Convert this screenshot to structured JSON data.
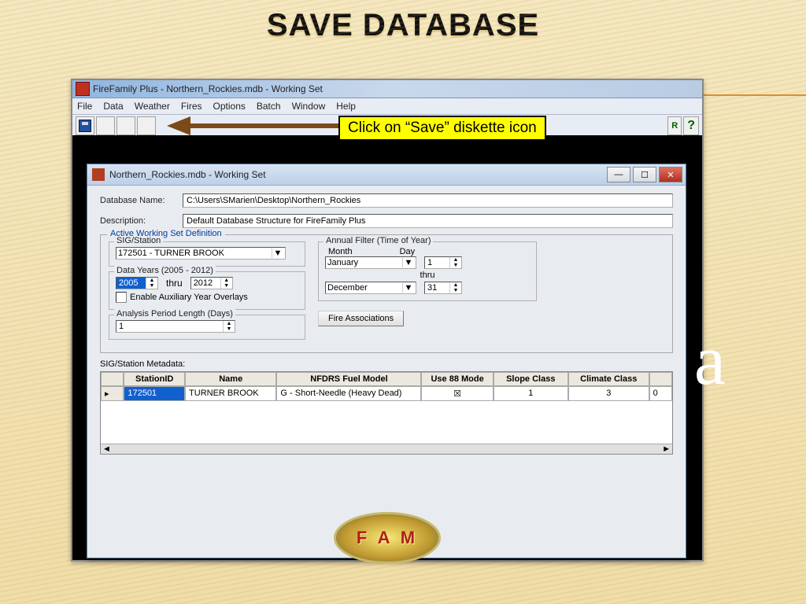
{
  "slide": {
    "title": "SAVE DATABASE"
  },
  "callout": "Click on “Save” diskette icon",
  "app": {
    "title": "FireFamily Plus - Northern_Rockies.mdb - Working Set",
    "menu": [
      "File",
      "Data",
      "Weather",
      "Fires",
      "Options",
      "Batch",
      "Window",
      "Help"
    ],
    "toolbar_r": "R",
    "toolbar_help": "?"
  },
  "dialog": {
    "title": "Northern_Rockies.mdb - Working Set",
    "db_label": "Database Name:",
    "db_value": "C:\\Users\\SMarien\\Desktop\\Northern_Rockies",
    "desc_label": "Description:",
    "desc_value": "Default Database Structure for FireFamily Plus",
    "group": "Active Working Set Definition",
    "sig_legend": "SIG/Station",
    "sig_value": "172501 - TURNER BROOK",
    "years_legend": "Data Years (2005 - 2012)",
    "year_from": "2005",
    "thru": "thru",
    "year_to": "2012",
    "aux_label": "Enable Auxiliary Year Overlays",
    "period_legend": "Analysis Period Length (Days)",
    "period_value": "1",
    "annual_legend": "Annual Filter (Time of Year)",
    "month_hdr": "Month",
    "day_hdr": "Day",
    "month_from": "January",
    "day_from": "1",
    "month_to": "December",
    "day_to": "31",
    "fire_btn": "Fire Associations",
    "meta_label": "SIG/Station Metadata:",
    "cols": {
      "id": "StationID",
      "name": "Name",
      "fuel": "NFDRS Fuel Model",
      "use88": "Use 88 Mode",
      "slope": "Slope Class",
      "climate": "Climate Class"
    },
    "row": {
      "id": "172501",
      "name": "TURNER BROOK",
      "fuel": "G - Short-Needle (Heavy Dead)",
      "use88": "☒",
      "slope": "1",
      "climate": "3"
    }
  },
  "badge": "F A M",
  "letter": "a"
}
